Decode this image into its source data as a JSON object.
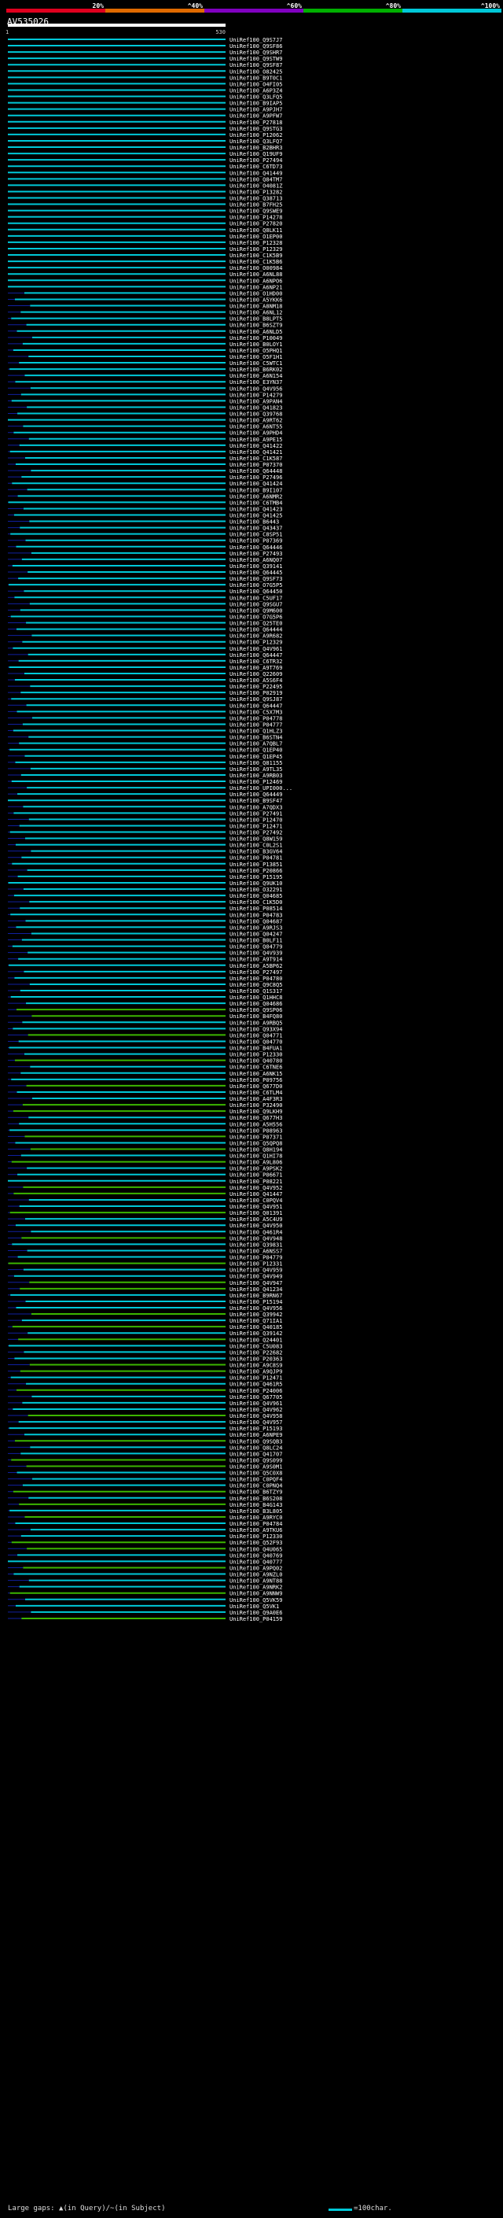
{
  "query": {
    "name": "AV535026"
  },
  "palette": {
    "bar_colors": [
      "#e0001e",
      "#e06a00",
      "#8000c0",
      "#00b000",
      "#00c8d8"
    ],
    "hit_cyan": "#00c8d8",
    "hit_green": "#3cb500",
    "hit_blue": "#1020a0",
    "query_bar": "#ffffff"
  },
  "chart_data": {
    "type": "alignment-overview",
    "query_length": 530,
    "scale": {
      "start_label": "1",
      "end_label": "530"
    },
    "identity_ticks": [
      "20%",
      "^40%",
      "^60%",
      "^80%",
      "^100%"
    ],
    "hits": [
      "UniRef100_Q9S7J7",
      "UniRef100_Q9SF86",
      "UniRef100_Q9SHR7",
      "UniRef100_Q9STW9",
      "UniRef100_Q9SF87",
      "UniRef100_O82425",
      "UniRef100_B9T0C1",
      "UniRef100_O4FI05",
      "UniRef100_A6P3Z4",
      "UniRef100_Q3LFQ5",
      "UniRef100_B9IAP5",
      "UniRef100_A9PJH7",
      "UniRef100_A9PFW7",
      "UniRef100_P27818",
      "UniRef100_Q9STG3",
      "UniRef100_P12062",
      "UniRef100_Q3LFQ7",
      "UniRef100_B2BHR3",
      "UniRef100_Q19UF9",
      "UniRef100_P27494",
      "UniRef100_C6TD73",
      "UniRef100_Q41449",
      "UniRef100_Q84TM7",
      "UniRef100_O4081Z",
      "UniRef100_P13282",
      "UniRef100_Q38713",
      "UniRef100_B7FH25",
      "UniRef100_Q9SWE9",
      "UniRef100_P14278",
      "UniRef100_P27820",
      "UniRef100_Q8LK11",
      "UniRef100_O1EP00",
      "UniRef100_P12328",
      "UniRef100_P12329",
      "UniRef100_C1K5B9",
      "UniRef100_C1K5B6",
      "UniRef100_O00984",
      "UniRef100_A6NL88",
      "UniRef100_A6NPO6",
      "UniRef100_A6NP21",
      "UniRef100_O1HD00",
      "UniRef100_A5YKK6",
      "UniRef100_A8NM18",
      "UniRef100_A6NL12",
      "UniRef100_B8LPT5",
      "UniRef100_B6SZT9",
      "UniRef100_A6NLD5",
      "UniRef100_P10049",
      "UniRef100_B0LOY1",
      "UniRef100_O5PHQ1",
      "UniRef100_O5F1H1",
      "UniRef100_C5WTC1",
      "UniRef100_B6RK02",
      "UniRef100_A6N154",
      "UniRef100_E3YN37",
      "UniRef100_Q4V956",
      "UniRef100_P14279",
      "UniRef100_A9PAN4",
      "UniRef100_Q41823",
      "UniRef100_Q39768",
      "UniRef100_A9RT62",
      "UniRef100_A6NT55",
      "UniRef100_A9PHD4",
      "UniRef100_A9PE15",
      "UniRef100_Q41422",
      "UniRef100_Q41421",
      "UniRef100_C1K587",
      "UniRef100_P07370",
      "UniRef100_Q64448",
      "UniRef100_P27496",
      "UniRef100_Q41424",
      "UniRef100_B9I107",
      "UniRef100_A6NMR2",
      "UniRef100_C6TMB4",
      "UniRef100_Q41423",
      "UniRef100_Q41425",
      "UniRef100_B6443",
      "UniRef100_Q43437",
      "UniRef100_C8SP51",
      "UniRef100_P07369",
      "UniRef100_Q64446",
      "UniRef100_P27493",
      "UniRef100_A6NQ07",
      "UniRef100_Q39141",
      "UniRef100_Q64445",
      "UniRef100_Q9SF73",
      "UniRef100_O7G5P5",
      "UniRef100_Q64450",
      "UniRef100_C5UF17",
      "UniRef100_Q9SGU7",
      "UniRef100_Q9M600",
      "UniRef100_O7G5P6",
      "UniRef100_Q25TE0",
      "UniRef100_Q64444",
      "UniRef100_A9R682",
      "UniRef100_P12329",
      "UniRef100_Q4V961",
      "UniRef100_Q64447",
      "UniRef100_C6TR32",
      "UniRef100_A9T769",
      "UniRef100_Q22609",
      "UniRef100_A5S6F4",
      "UniRef100_P22495",
      "UniRef100_P02919",
      "UniRef100_Q9SJ87",
      "UniRef100_Q64447",
      "UniRef100_C5X7M3",
      "UniRef100_P04778",
      "UniRef100_P04777",
      "UniRef100_Q1HLZ3",
      "UniRef100_B6STN4",
      "UniRef100_A7QBL7",
      "UniRef100_Q1EP40",
      "UniRef100_Q1EP45",
      "UniRef100_Q81155",
      "UniRef100_A9TL35",
      "UniRef100_A9RB03",
      "UniRef100_P12469",
      "UniRef100_UPI000...",
      "UniRef100_Q64449",
      "UniRef100_B9SF47",
      "UniRef100_A7QDX3",
      "UniRef100_P27491",
      "UniRef100_P12470",
      "UniRef100_P12471",
      "UniRef100_P27492",
      "UniRef100_Q8W159",
      "UniRef100_C0L2S1",
      "UniRef100_B3GV64",
      "UniRef100_P04781",
      "UniRef100_P13851",
      "UniRef100_P20866",
      "UniRef100_P15195",
      "UniRef100_Q9UK10",
      "UniRef100_O32291",
      "UniRef100_Q04685",
      "UniRef100_C1K5D0",
      "UniRef100_P08514",
      "UniRef100_P04783",
      "UniRef100_Q04687",
      "UniRef100_A9RJS3",
      "UniRef100_Q04247",
      "UniRef100_B0LF11",
      "UniRef100_Q04779",
      "UniRef100_Q4V939",
      "UniRef100_A9T914",
      "UniRef100_A5BP62",
      "UniRef100_P27497",
      "UniRef100_P04780",
      "UniRef100_Q9C8Q5",
      "UniRef100_Q1S317",
      "UniRef100_Q1HHC8",
      "UniRef100_Q04686",
      "UniRef100_Q9SP06",
      "UniRef100_B4FQ80",
      "UniRef100_A9RBQ5",
      "UniRef100_Q93X94",
      "UniRef100_Q04771",
      "UniRef100_Q04770",
      "UniRef100_B4FUA1",
      "UniRef100_P12330",
      "UniRef100_Q40780",
      "UniRef100_C6TNE6",
      "UniRef100_A6NK15",
      "UniRef100_P09756",
      "UniRef100_Q677D0",
      "UniRef100_C6TLM4",
      "UniRef100_A4F3R3",
      "UniRef100_P32490",
      "UniRef100_Q9LKH9",
      "UniRef100_Q677H3",
      "UniRef100_A5H556",
      "UniRef100_P08963",
      "UniRef100_P07371",
      "UniRef100_Q5QPQ8",
      "UniRef100_Q8H194",
      "UniRef100_Q1HI78",
      "UniRef100_A9L806",
      "UniRef100_A9PSK2",
      "UniRef100_P06671",
      "UniRef100_P08221",
      "UniRef100_Q4V952",
      "UniRef100_Q41447",
      "UniRef100_C0PQV4",
      "UniRef100_Q4V951",
      "UniRef100_Q01391",
      "UniRef100_A5C4U9",
      "UniRef100_Q4V950",
      "UniRef100_Q461R4",
      "UniRef100_Q4V948",
      "UniRef100_Q39831",
      "UniRef100_A6NSS7",
      "UniRef100_P04779",
      "UniRef100_P12331",
      "UniRef100_Q4V959",
      "UniRef100_Q4V949",
      "UniRef100_Q4V947",
      "UniRef100_Q41234",
      "UniRef100_B9RN67",
      "UniRef100_P15194",
      "UniRef100_Q4V956",
      "UniRef100_Q39942",
      "UniRef100_Q71IA1",
      "UniRef100_Q40185",
      "UniRef100_Q39142",
      "UniRef100_Q24401",
      "UniRef100_C5U083",
      "UniRef100_P22682",
      "UniRef100_P20363",
      "UniRef100_A9C8S9",
      "UniRef100_A9QJP9",
      "UniRef100_P12471",
      "UniRef100_Q461R5",
      "UniRef100_P24006",
      "UniRef100_Q67705",
      "UniRef100_Q4V961",
      "UniRef100_Q4V962",
      "UniRef100_Q4V958",
      "UniRef100_Q4V957",
      "UniRef100_P15193",
      "UniRef100_A6NPE9",
      "UniRef100_Q9SQB3",
      "UniRef100_Q8LC24",
      "UniRef100_Q41707",
      "UniRef100_Q9S099",
      "UniRef100_A9S0M1",
      "UniRef100_Q5C0X8",
      "UniRef100_C0PQF4",
      "UniRef100_C0PNQ4",
      "UniRef100_B6TZY9",
      "UniRef100_B6S208",
      "UniRef100_B4G143",
      "UniRef100_B3L805",
      "UniRef100_A9RYC0",
      "UniRef100_P04784",
      "UniRef100_A9TKU6",
      "UniRef100_P12330",
      "UniRef100_Q52F93",
      "UniRef100_Q4U065",
      "UniRef100_Q40769",
      "UniRef100_Q40777",
      "UniRef100_A9PQ02",
      "UniRef100_A9NZL0",
      "UniRef100_A9NT88",
      "UniRef100_A9NRK2",
      "UniRef100_A9NNW9",
      "UniRef100_Q5VK59",
      "UniRef100_Q5VK1",
      "UniRef100_Q9A0E6",
      "UniRef100_P04159"
    ]
  },
  "footer": {
    "legend": "Large gaps: ▲(in Query)/~(in Subject)",
    "scale": "=100char."
  }
}
